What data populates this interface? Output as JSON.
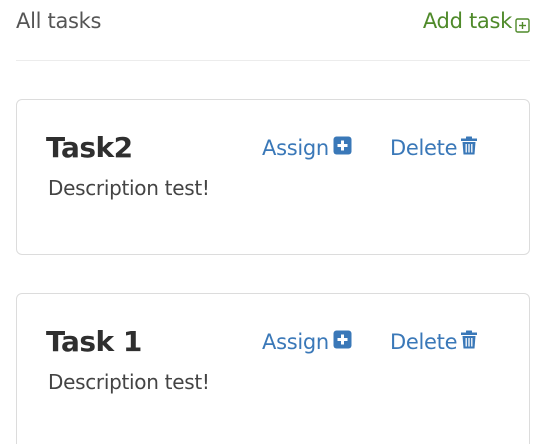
{
  "header": {
    "title": "All tasks",
    "add_task_label": "Add task"
  },
  "tasks": [
    {
      "title": "Task2",
      "description": "Description test!",
      "assign_label": "Assign",
      "delete_label": "Delete"
    },
    {
      "title": "Task 1",
      "description": "Description test!",
      "assign_label": "Assign",
      "delete_label": "Delete"
    }
  ],
  "icons": {
    "add_task": "plus-square-outline-icon",
    "assign": "plus-square-icon",
    "delete": "trash-icon"
  },
  "colors": {
    "add_task": "#4f8a2a",
    "action_link": "#3a78b8",
    "title_text": "#2f2f2f",
    "header_text": "#555555"
  }
}
